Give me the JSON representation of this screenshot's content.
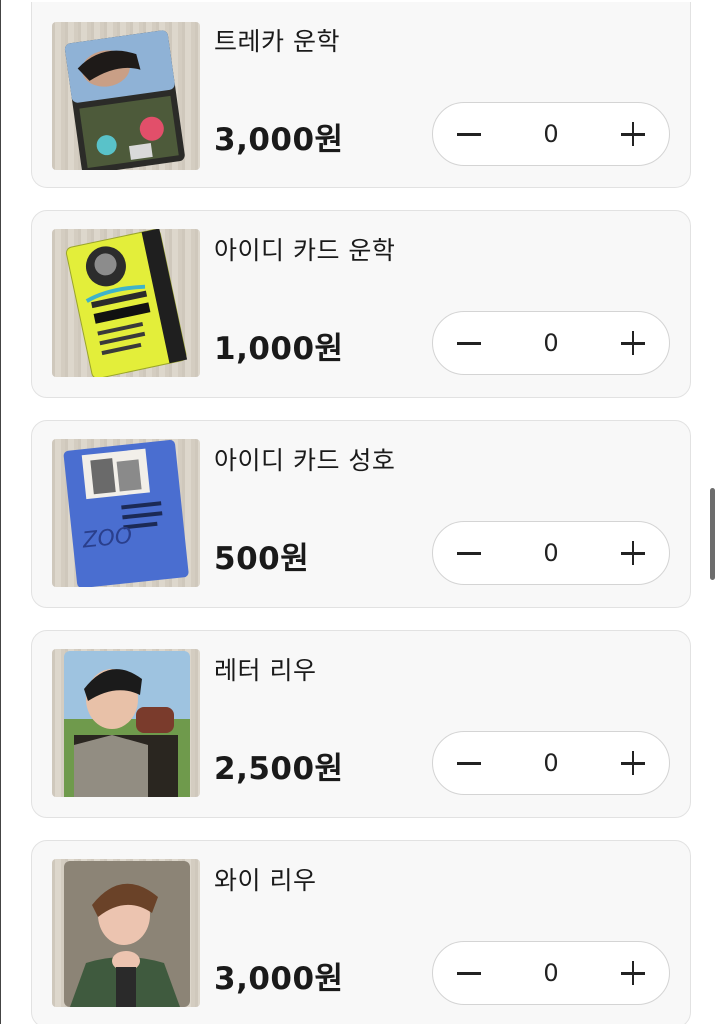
{
  "products": [
    {
      "name": "트레카 운학",
      "price": "3,000원",
      "quantity": "0",
      "image": "photocard-blue-flowers",
      "accent": "#6b7d5c"
    },
    {
      "name": "아이디 카드 운학",
      "price": "1,000원",
      "quantity": "0",
      "image": "id-card-yellow",
      "accent": "#e6f03c"
    },
    {
      "name": "아이디 카드 성호",
      "price": "500원",
      "quantity": "0",
      "image": "id-card-blue",
      "accent": "#4a6ed0"
    },
    {
      "name": "레터 리우",
      "price": "2,500원",
      "quantity": "0",
      "image": "photocard-portrait",
      "accent": "#3a3a3a"
    },
    {
      "name": "와이 리우",
      "price": "3,000원",
      "quantity": "0",
      "image": "photocard-portrait-green",
      "accent": "#3f5a3e"
    }
  ],
  "icons": {
    "decrement": "minus-icon",
    "increment": "plus-icon"
  }
}
